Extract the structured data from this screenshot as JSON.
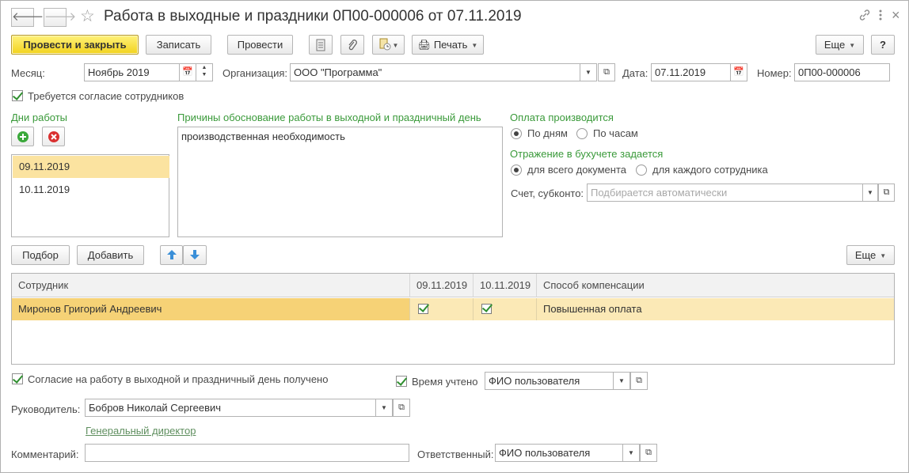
{
  "title": "Работа в выходные и праздники 0П00-000006 от 07.11.2019",
  "nav": {
    "back_icon": "arrow-left-icon",
    "forward_icon": "arrow-right-icon"
  },
  "toolbar": {
    "post_close_label": "Провести и закрыть",
    "save_label": "Записать",
    "post_label": "Провести",
    "print_label": "Печать",
    "more_label": "Еще",
    "help_label": "?"
  },
  "fields": {
    "month_label": "Месяц:",
    "month_value": "Ноябрь 2019",
    "org_label": "Организация:",
    "org_value": "ООО \"Программа\"",
    "date_label": "Дата:",
    "date_value": "07.11.2019",
    "number_label": "Номер:",
    "number_value": "0П00-000006"
  },
  "consent_required_label": "Требуется согласие сотрудников",
  "work_days": {
    "title": "Дни работы",
    "items": [
      "09.11.2019",
      "10.11.2019"
    ]
  },
  "reasons": {
    "title": "Причины обоснование работы в выходной и праздничный день",
    "value": "производственная необходимость"
  },
  "payment": {
    "title": "Оплата производится",
    "opt_days": "По дням",
    "opt_hours": "По часам",
    "selected": "По дням"
  },
  "accounting": {
    "title": "Отражение в бухучете задается",
    "opt_doc": "для всего документа",
    "opt_emp": "для каждого сотрудника",
    "selected": "для всего документа",
    "account_label": "Счет, субконто:",
    "account_placeholder": "Подбирается автоматически"
  },
  "table_toolbar": {
    "pick_label": "Подбор",
    "add_label": "Добавить",
    "more_label": "Еще"
  },
  "table": {
    "columns": [
      "Сотрудник",
      "09.11.2019",
      "10.11.2019",
      "Способ компенсации"
    ],
    "rows": [
      {
        "employee": "Миронов Григорий Андреевич",
        "d1": true,
        "d2": true,
        "compensation": "Повышенная оплата"
      }
    ]
  },
  "footer": {
    "consent_received_label": "Согласие на работу в выходной и праздничный день получено",
    "time_accounted_label": "Время учтено",
    "time_accounted_value": "ФИО пользователя",
    "manager_label": "Руководитель:",
    "manager_value": "Бобров Николай Сергеевич",
    "manager_position": "Генеральный директор",
    "comment_label": "Комментарий:",
    "comment_value": "",
    "responsible_label": "Ответственный:",
    "responsible_value": "ФИО пользователя"
  }
}
